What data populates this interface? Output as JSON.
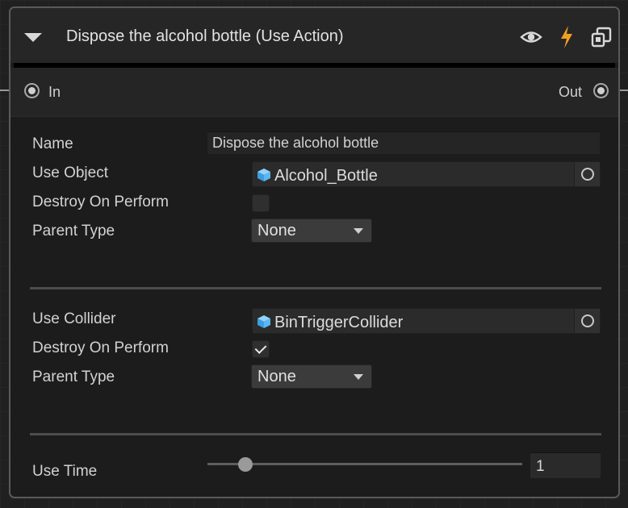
{
  "node": {
    "title": "Dispose the alcohol bottle (Use Action)",
    "icons": [
      "eye-icon",
      "lightning-icon",
      "debug-window-icon"
    ],
    "accent_color": "#f0a020"
  },
  "ports": {
    "in_label": "In",
    "out_label": "Out"
  },
  "fields": {
    "name_label": "Name",
    "name_value": "Dispose the alcohol bottle",
    "use_object_label": "Use Object",
    "use_object_value": "Alcohol_Bottle",
    "destroy_on_perform_1_label": "Destroy On Perform",
    "destroy_on_perform_1_checked": false,
    "parent_type_1_label": "Parent Type",
    "parent_type_1_value": "None",
    "use_collider_label": "Use Collider",
    "use_collider_value": "BinTriggerCollider",
    "destroy_on_perform_2_label": "Destroy On Perform",
    "destroy_on_perform_2_checked": true,
    "parent_type_2_label": "Parent Type",
    "parent_type_2_value": "None",
    "use_time_label": "Use Time",
    "use_time_value": "1",
    "use_time_slider_fraction": 0.12
  }
}
